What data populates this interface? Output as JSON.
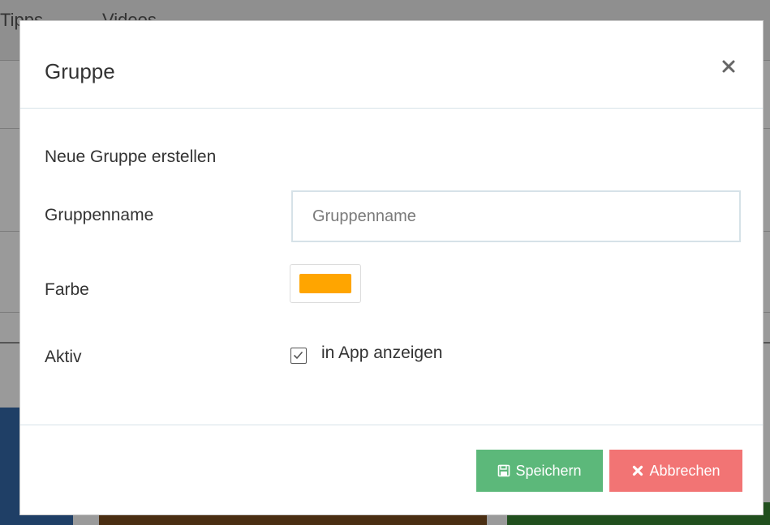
{
  "background": {
    "nav_items": [
      "Tipps",
      "Videos"
    ]
  },
  "modal": {
    "title": "Gruppe",
    "close_icon": "close-icon",
    "subtitle": "Neue Gruppe erstellen",
    "fields": {
      "name_label": "Gruppenname",
      "name_value": "",
      "name_placeholder": "Gruppenname",
      "color_label": "Farbe",
      "color_value": "#FFA500",
      "active_label": "Aktiv",
      "active_checkbox_label": "in App anzeigen",
      "active_checked": true
    },
    "footer": {
      "save_label": "Speichern",
      "save_icon": "floppy-disk-icon",
      "save_color": "#5cb87a",
      "cancel_label": "Abbrechen",
      "cancel_icon": "close-icon",
      "cancel_color": "#f27474"
    }
  }
}
